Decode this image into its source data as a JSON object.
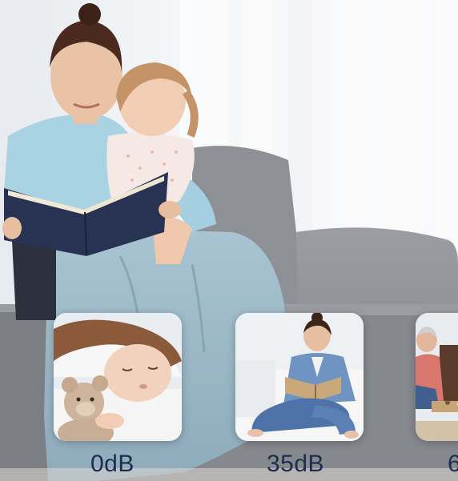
{
  "scene": {
    "illustration": "mother-reading-to-child-on-sofa"
  },
  "levels": [
    {
      "label": "0dB",
      "illustration": "sleeping-child-with-teddy-bear"
    },
    {
      "label": "35dB",
      "illustration": "woman-reading-on-floor"
    },
    {
      "label": "6",
      "illustration": "man-playing-board-game"
    }
  ],
  "colors": {
    "label_text": "#1e2c4d",
    "sofa": "#8f9296",
    "blanket": "#9fbcca",
    "shirt": "#a9d3e3"
  }
}
